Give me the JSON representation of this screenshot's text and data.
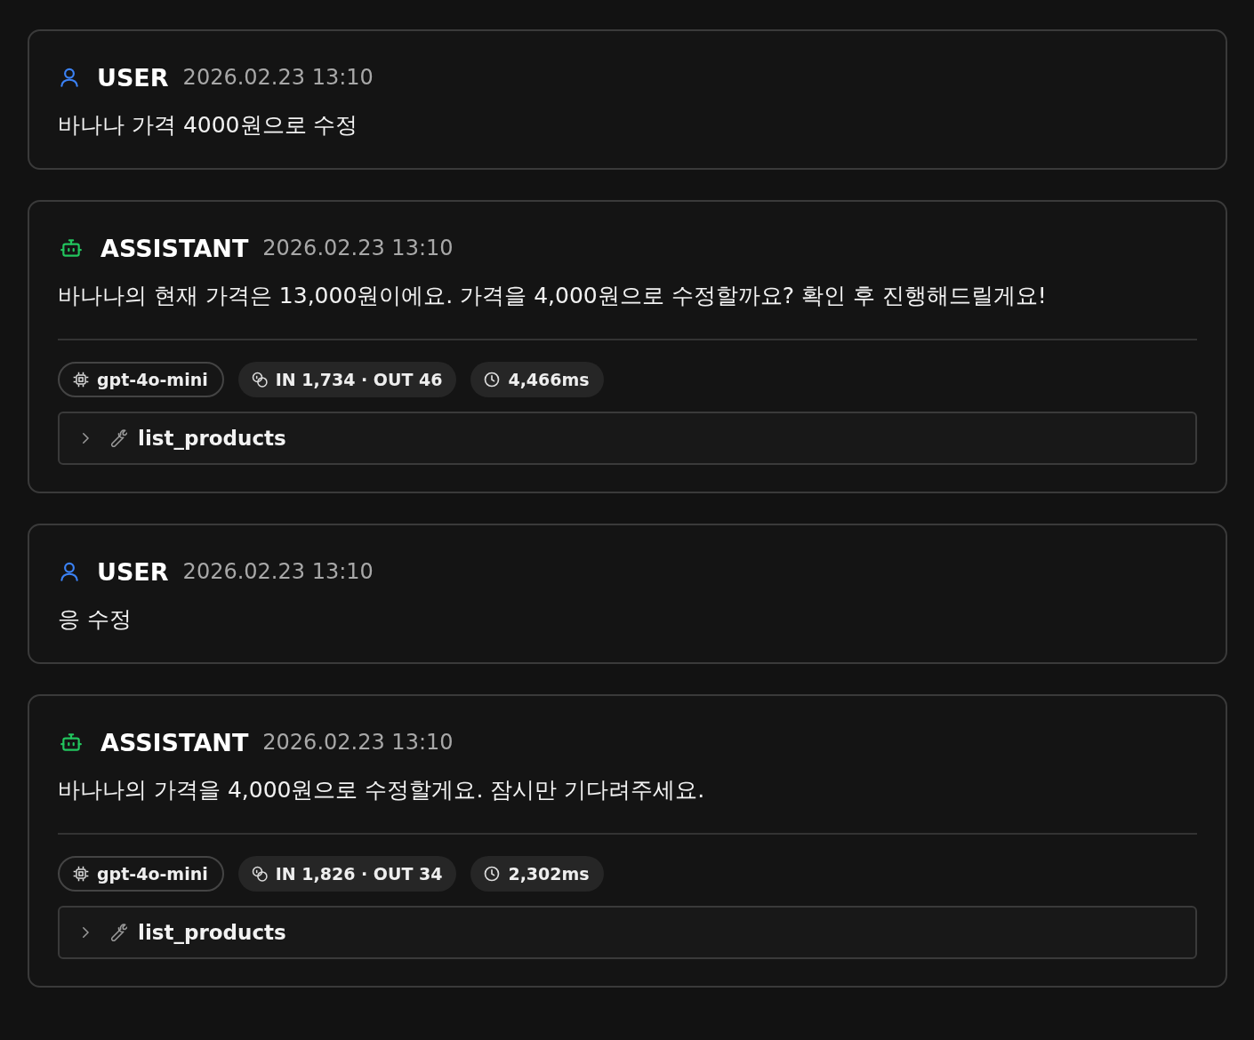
{
  "messages": [
    {
      "kind": "user",
      "role": "USER",
      "time": "2026.02.23 13:10",
      "text": "바나나 가격 4000원으로 수정"
    },
    {
      "kind": "assistant",
      "role": "ASSISTANT",
      "time": "2026.02.23 13:10",
      "text": "바나나의 현재 가격은 13,000원이에요. 가격을 4,000원으로 수정할까요? 확인 후 진행해드릴게요!",
      "model": "gpt-4o-mini",
      "tokens": "IN 1,734 · OUT 46",
      "duration": "4,466ms",
      "tool": {
        "name": "list_products",
        "expanded": false
      }
    },
    {
      "kind": "user",
      "role": "USER",
      "time": "2026.02.23 13:10",
      "text": "응 수정"
    },
    {
      "kind": "assistant",
      "role": "ASSISTANT",
      "time": "2026.02.23 13:10",
      "text": "바나나의 가격을 4,000원으로 수정할게요. 잠시만 기다려주세요.",
      "model": "gpt-4o-mini",
      "tokens": "IN 1,826 · OUT 34",
      "duration": "2,302ms",
      "tool": {
        "name": "list_products",
        "expanded": false
      }
    }
  ]
}
